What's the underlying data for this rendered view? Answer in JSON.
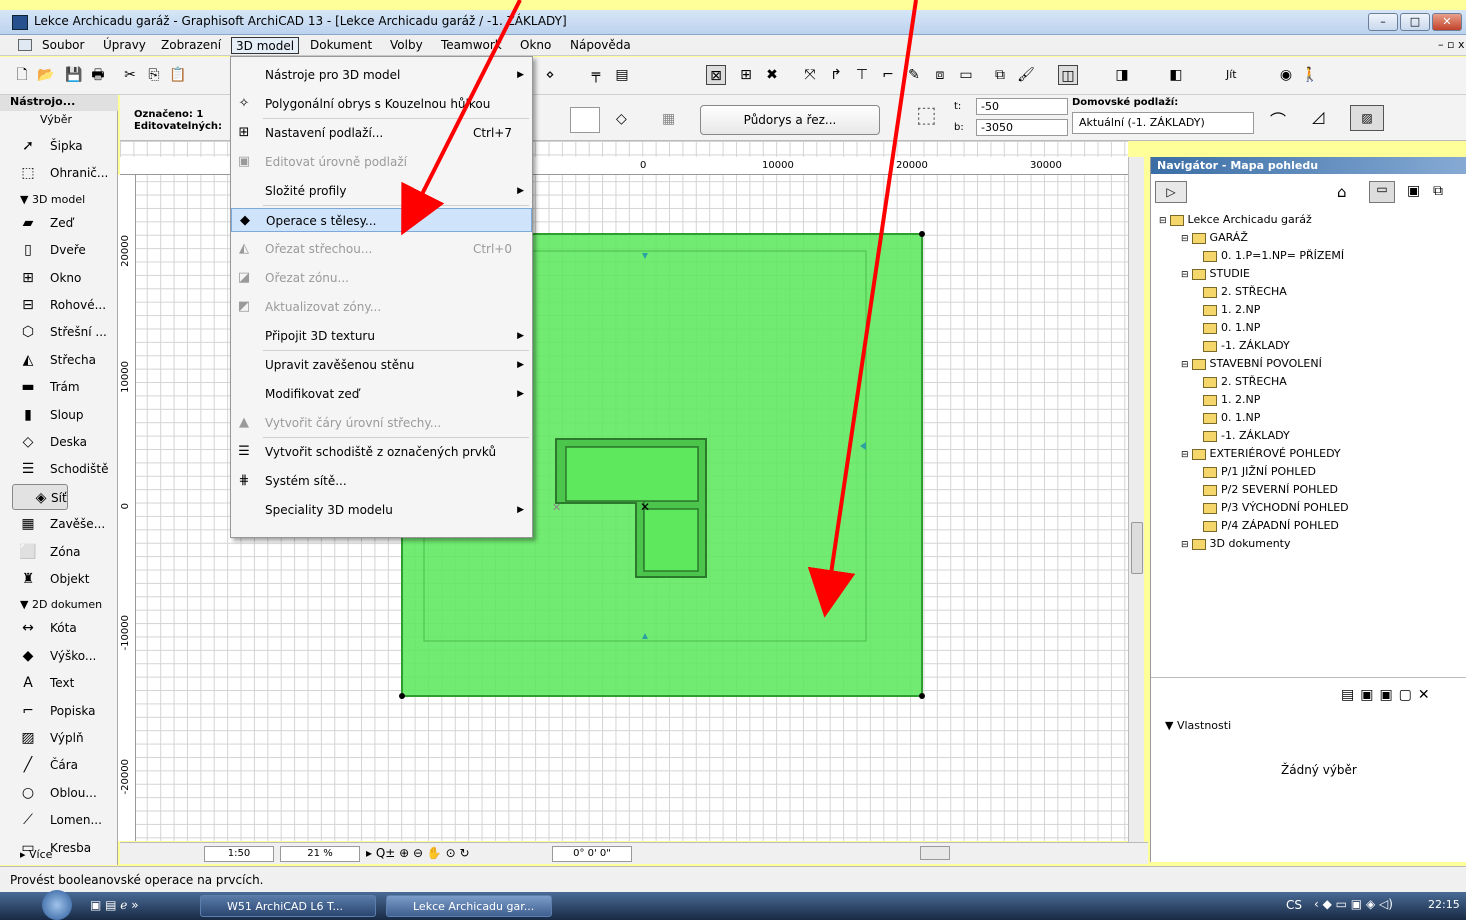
{
  "window": {
    "title": "Lekce Archicadu garáž - Graphisoft ArchiCAD 13 - [Lekce Archicadu garáž / -1. ZÁKLADY]"
  },
  "menubar": [
    "Soubor",
    "Úpravy",
    "Zobrazení",
    "3D model",
    "Dokument",
    "Volby",
    "Teamwork",
    "Okno",
    "Nápověda"
  ],
  "toolbox": {
    "title": "Nástrojo...",
    "select_label": "Výběr",
    "tools": [
      {
        "label": "Šipka",
        "icon": "arrow-icon"
      },
      {
        "label": "Ohranič...",
        "icon": "marquee-icon"
      }
    ],
    "section_3d": "3D model",
    "tools_3d": [
      {
        "label": "Zeď",
        "icon": "wall-icon"
      },
      {
        "label": "Dveře",
        "icon": "door-icon"
      },
      {
        "label": "Okno",
        "icon": "window-icon"
      },
      {
        "label": "Rohové...",
        "icon": "corner-window-icon"
      },
      {
        "label": "Střešní ...",
        "icon": "skylight-icon"
      },
      {
        "label": "Střecha",
        "icon": "roof-icon"
      },
      {
        "label": "Trám",
        "icon": "beam-icon"
      },
      {
        "label": "Sloup",
        "icon": "column-icon"
      },
      {
        "label": "Deska",
        "icon": "slab-icon"
      },
      {
        "label": "Schodiště",
        "icon": "stair-icon"
      },
      {
        "label": "Síť",
        "icon": "mesh-icon"
      },
      {
        "label": "Zavěše...",
        "icon": "curtain-wall-icon"
      },
      {
        "label": "Zóna",
        "icon": "zone-icon"
      },
      {
        "label": "Objekt",
        "icon": "object-icon"
      }
    ],
    "section_2d": "2D dokumen",
    "tools_2d": [
      {
        "label": "Kóta",
        "icon": "dimension-icon"
      },
      {
        "label": "Výško...",
        "icon": "level-icon"
      },
      {
        "label": "Text",
        "icon": "text-icon"
      },
      {
        "label": "Popiska",
        "icon": "label-icon"
      },
      {
        "label": "Výplň",
        "icon": "fill-icon"
      },
      {
        "label": "Čára",
        "icon": "line-icon"
      },
      {
        "label": "Oblou...",
        "icon": "arc-icon"
      },
      {
        "label": "Lomen...",
        "icon": "polyline-icon"
      },
      {
        "label": "Kresba",
        "icon": "drawing-icon"
      }
    ],
    "more": "Více"
  },
  "infobox": {
    "marked": "Označeno: 1",
    "editable": "Editovatelných:",
    "plan_section_btn": "Půdorys a řez...",
    "t_label": "t:",
    "t_value": "-50",
    "b_label": "b:",
    "b_value": "-3050",
    "home_story_label": "Domovské podlaží:",
    "home_story_value": "Aktuální (-1. ZÁKLADY)",
    "goto": "Jít"
  },
  "ruler": {
    "h_ticks": [
      "0",
      "10000",
      "20000",
      "30000"
    ],
    "v_ticks": [
      "20000",
      "10000",
      "0",
      "-10000",
      "-20000"
    ]
  },
  "menu": {
    "items": [
      {
        "label": "Nástroje pro 3D model",
        "submenu": true,
        "icon": ""
      },
      {
        "label": "Polygonální obrys s Kouzelnou hůlkou",
        "icon": "magic-wand-icon"
      },
      {
        "label": "Nastavení podlaží...",
        "shortcut": "Ctrl+7",
        "icon": "story-settings-icon"
      },
      {
        "label": "Editovat úrovně podlaží",
        "disabled": true,
        "icon": "story-levels-icon"
      },
      {
        "label": "Složité profily",
        "submenu": true,
        "icon": ""
      },
      {
        "label": "Operace s tělesy...",
        "highlighted": true,
        "icon": "solid-ops-icon"
      },
      {
        "label": "Ořezat střechou...",
        "shortcut": "Ctrl+0",
        "disabled": true,
        "icon": "trim-roof-icon"
      },
      {
        "label": "Ořezat zónu...",
        "disabled": true,
        "icon": "trim-zone-icon"
      },
      {
        "label": "Aktualizovat zóny...",
        "disabled": true,
        "icon": "update-zones-icon"
      },
      {
        "label": "Připojit 3D texturu",
        "submenu": true,
        "icon": ""
      },
      {
        "label": "Upravit zavěšenou stěnu",
        "submenu": true,
        "icon": ""
      },
      {
        "label": "Modifikovat zeď",
        "submenu": true,
        "icon": ""
      },
      {
        "label": "Vytvořit čáry úrovní střechy...",
        "disabled": true,
        "icon": "roof-lines-icon"
      },
      {
        "label": "Vytvořit schodiště z označených prvků",
        "icon": "stair-create-icon"
      },
      {
        "label": "Systém sítě...",
        "icon": "grid-system-icon"
      },
      {
        "label": "Speciality 3D modelu",
        "submenu": true,
        "icon": ""
      }
    ]
  },
  "navigator": {
    "title": "Navigátor - Mapa pohledu",
    "tree": [
      {
        "label": "Lekce Archicadu garáž",
        "level": 0
      },
      {
        "label": "GARÁŽ",
        "level": 1
      },
      {
        "label": "0. 1.P=1.NP= PŘÍZEMÍ",
        "level": 2
      },
      {
        "label": "STUDIE",
        "level": 1
      },
      {
        "label": "2. STŘECHA",
        "level": 2
      },
      {
        "label": "1. 2.NP",
        "level": 2
      },
      {
        "label": "0. 1.NP",
        "level": 2
      },
      {
        "label": "-1. ZÁKLADY",
        "level": 2
      },
      {
        "label": "STAVEBNÍ POVOLENÍ",
        "level": 1
      },
      {
        "label": "2. STŘECHA",
        "level": 2
      },
      {
        "label": "1. 2.NP",
        "level": 2
      },
      {
        "label": "0. 1.NP",
        "level": 2
      },
      {
        "label": "-1. ZÁKLADY",
        "level": 2
      },
      {
        "label": "EXTERIÉROVÉ POHLEDY",
        "level": 1
      },
      {
        "label": "P/1 JIŽNÍ POHLED",
        "level": 2
      },
      {
        "label": "P/2 SEVERNÍ POHLED",
        "level": 2
      },
      {
        "label": "P/3 VÝCHODNÍ POHLED",
        "level": 2
      },
      {
        "label": "P/4 ZÁPADNÍ POHLED",
        "level": 2
      },
      {
        "label": "3D dokumenty",
        "level": 1
      }
    ],
    "properties": "Vlastnosti",
    "no_selection": "Žádný výběr"
  },
  "bottom_bar": {
    "scale": "1:50",
    "zoom": "21 %",
    "angle": "0° 0' 0\""
  },
  "status": "Provést booleanovské operace na prvcích.",
  "taskbar": {
    "tasks": [
      "W51 ArchiCAD L6 T...",
      "Lekce Archicadu gar..."
    ],
    "lang": "CS",
    "clock": "22:15"
  },
  "colors": {
    "slab": "#5ee85e",
    "slab_border": "#2e9e2e",
    "highlight": "#cfe3fb",
    "annotation": "#ff0000"
  }
}
